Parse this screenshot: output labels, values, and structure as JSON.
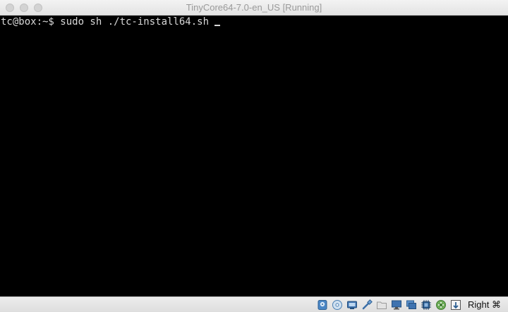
{
  "window": {
    "title": "TinyCore64-7.0-en_US [Running]"
  },
  "terminal": {
    "line": "tc@box:~$ sudo sh ./tc-install64.sh"
  },
  "statusbar": {
    "icons": [
      "hard-disk-icon",
      "optical-disk-icon",
      "audio-icon",
      "usb-icon",
      "shared-folders-icon",
      "display-icon",
      "video-capture-icon",
      "cpu-icon",
      "network-icon",
      "mouse-integration-icon"
    ],
    "host_key": "Right ⌘"
  }
}
